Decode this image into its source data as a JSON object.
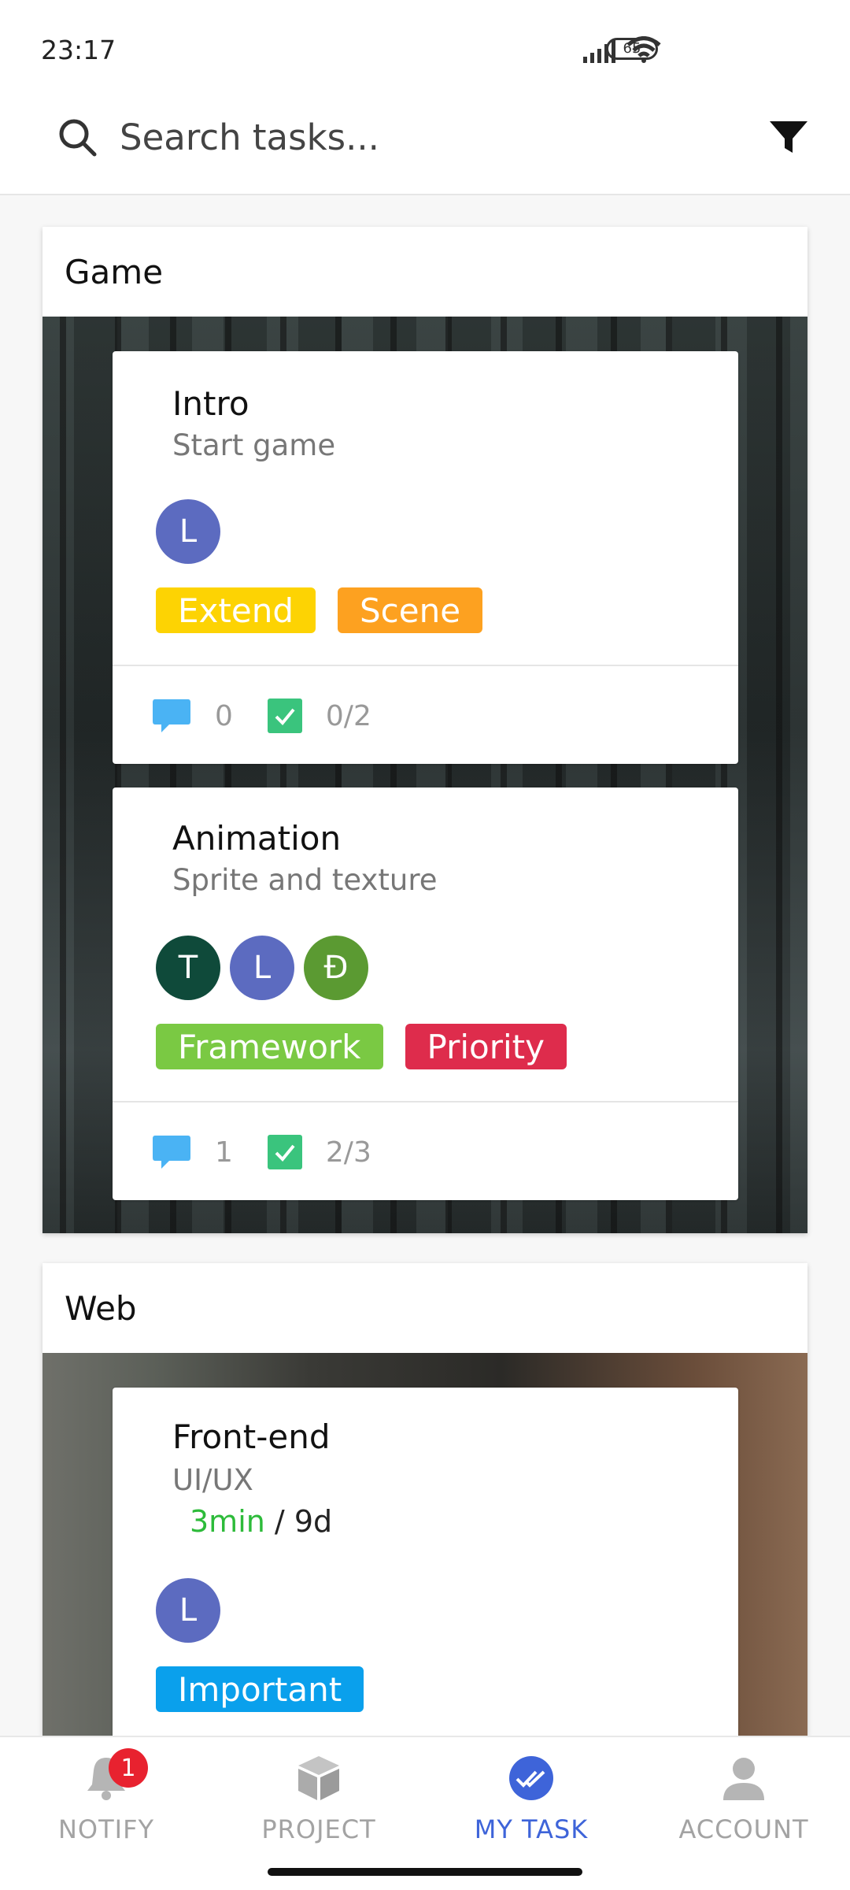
{
  "status": {
    "time": "23:17",
    "battery": "65"
  },
  "search": {
    "placeholder": "Search tasks..."
  },
  "projects": [
    {
      "name": "Game",
      "tasks": [
        {
          "title": "Intro",
          "subtitle": "Start game",
          "avatars": [
            {
              "letter": "L",
              "color": "#5c6bc0"
            }
          ],
          "tags": [
            {
              "label": "Extend",
              "color": "#fdd303"
            },
            {
              "label": "Scene",
              "color": "#fda120"
            }
          ],
          "comments": "0",
          "checklist": "0/2"
        },
        {
          "title": "Animation",
          "subtitle": "Sprite and texture",
          "avatars": [
            {
              "letter": "T",
              "color": "#0f4a3a"
            },
            {
              "letter": "L",
              "color": "#5c6bc0"
            },
            {
              "letter": "Đ",
              "color": "#5b9a32"
            }
          ],
          "tags": [
            {
              "label": "Framework",
              "color": "#7ac943"
            },
            {
              "label": "Priority",
              "color": "#de2c4c"
            }
          ],
          "comments": "1",
          "checklist": "2/3"
        }
      ]
    },
    {
      "name": "Web",
      "tasks": [
        {
          "title": "Front-end",
          "subtitle": "UI/UX",
          "time_spent": "3min",
          "time_separator": " / ",
          "time_estimate": "9d",
          "avatars": [
            {
              "letter": "L",
              "color": "#5c6bc0"
            }
          ],
          "tags": [
            {
              "label": "Important",
              "color": "#0aa0ec"
            }
          ]
        }
      ]
    }
  ],
  "nav": {
    "items": [
      {
        "label": "NOTIFY",
        "icon": "bell-icon",
        "badge": "1"
      },
      {
        "label": "PROJECT",
        "icon": "cube-icon"
      },
      {
        "label": "MY TASK",
        "icon": "double-check-icon",
        "active": true
      },
      {
        "label": "ACCOUNT",
        "icon": "person-icon"
      }
    ]
  }
}
